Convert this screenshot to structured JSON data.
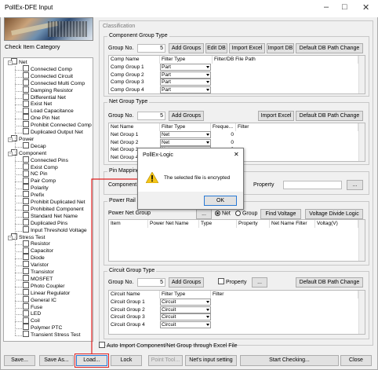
{
  "window": {
    "title": "PollEx-DFE Input"
  },
  "left": {
    "header": "Check Item Category",
    "tree": [
      {
        "label": "Net",
        "level": 0
      },
      {
        "label": "Connected Comp",
        "level": 1
      },
      {
        "label": "Connected Circuit",
        "level": 1
      },
      {
        "label": "Connected Multi Comp",
        "level": 1
      },
      {
        "label": "Damping Resistor",
        "level": 1
      },
      {
        "label": "Differential Net",
        "level": 1
      },
      {
        "label": "Exist Net",
        "level": 1
      },
      {
        "label": "Load Capacitance",
        "level": 1
      },
      {
        "label": "One Pin Net",
        "level": 1
      },
      {
        "label": "Prohibit Connected Comp",
        "level": 1
      },
      {
        "label": "Duplicated Output Net",
        "level": 1
      },
      {
        "label": "Power",
        "level": 0
      },
      {
        "label": "Decap",
        "level": 1
      },
      {
        "label": "Component",
        "level": 0
      },
      {
        "label": "Connected Pins",
        "level": 1
      },
      {
        "label": "Exist Comp",
        "level": 1
      },
      {
        "label": "NC Pin",
        "level": 1
      },
      {
        "label": "Pair Comp",
        "level": 1
      },
      {
        "label": "Polarity",
        "level": 1
      },
      {
        "label": "Prefix",
        "level": 1
      },
      {
        "label": "Prohibit Duplicated Net",
        "level": 1
      },
      {
        "label": "Prohibited Component",
        "level": 1
      },
      {
        "label": "Standard Net Name",
        "level": 1
      },
      {
        "label": "Duplicated Pins",
        "level": 1
      },
      {
        "label": "Input Threshold Voltage",
        "level": 1
      },
      {
        "label": "Stress Test",
        "level": 0
      },
      {
        "label": "Resistor",
        "level": 1
      },
      {
        "label": "Capacitor",
        "level": 1
      },
      {
        "label": "Diode",
        "level": 1
      },
      {
        "label": "Varistor",
        "level": 1
      },
      {
        "label": "Transistor",
        "level": 1
      },
      {
        "label": "MOSFET",
        "level": 1
      },
      {
        "label": "Photo Coupler",
        "level": 1
      },
      {
        "label": "Linear Regulator",
        "level": 1
      },
      {
        "label": "General IC",
        "level": 1
      },
      {
        "label": "Fuse",
        "level": 1
      },
      {
        "label": "LED",
        "level": 1
      },
      {
        "label": "Coil",
        "level": 1
      },
      {
        "label": "Polymer PTC",
        "level": 1
      },
      {
        "label": "Transient Stress Test",
        "level": 1
      }
    ]
  },
  "classification": {
    "header": "Classification",
    "component_group": {
      "title": "Component Group Type",
      "group_no_label": "Group No.",
      "group_no": "5",
      "buttons": [
        "Add Groups",
        "Edit DB",
        "Import Excel",
        "Import DB",
        "Default DB Path Change"
      ],
      "columns": [
        "Comp Name",
        "Filter Type",
        "Filter/DB File Path"
      ],
      "rows": [
        [
          "Comp Group 1",
          "Part"
        ],
        [
          "Comp Group 2",
          "Part"
        ],
        [
          "Comp Group 3",
          "Part"
        ],
        [
          "Comp Group 4",
          "Part"
        ]
      ]
    },
    "net_group": {
      "title": "Net Group Type",
      "group_no_label": "Group No.",
      "group_no": "5",
      "add_button": "Add Groups",
      "import_button": "Import Excel",
      "default_button": "Default DB Path Change",
      "columns": [
        "Net Name",
        "Filter Type",
        "Freque...",
        "Filter"
      ],
      "rows": [
        [
          "Net Group 1",
          "Net",
          "0"
        ],
        [
          "Net Group 2",
          "Net",
          "0"
        ],
        [
          "Net Group 3",
          "Net",
          "0"
        ],
        [
          "Net Group 4",
          "Net",
          "0"
        ]
      ]
    },
    "pin_mapping": {
      "title": "Pin Mapping",
      "component_label": "Component",
      "property_label": "Property",
      "browse": "..."
    },
    "power_rail": {
      "title": "Power Rail",
      "power_net_group_label": "Power Net Group",
      "browse": "...",
      "radio_net": "Net",
      "radio_group": "Group",
      "find_voltage": "Find Voltage",
      "voltage_divide": "Voltage Divide Logic",
      "columns": [
        "Item",
        "Power Net Name",
        "Type",
        "Property",
        "Net Name Filter",
        "Voltag(V)"
      ]
    },
    "circuit_group": {
      "title": "Circuit Group Type",
      "group_no_label": "Group No.",
      "group_no": "5",
      "add_button": "Add Groups",
      "property_label": "Property",
      "browse": "...",
      "default_button": "Default DB Path Change",
      "columns": [
        "Circuit Name",
        "Filter Type",
        "Filter"
      ],
      "rows": [
        [
          "Circuit Group 1",
          "Circuit"
        ],
        [
          "Circuit Group 2",
          "Circuit"
        ],
        [
          "Circuit Group 3",
          "Circuit"
        ],
        [
          "Circuit Group 4",
          "Circuit"
        ]
      ]
    },
    "auto_import_label": "Auto Import Component/Net Group through Excel File"
  },
  "bottom_buttons": {
    "save": "Save...",
    "save_as": "Save As...",
    "load": "Load...",
    "lock": "Lock",
    "point_tool": "Point Tool...",
    "nets_input": "Net's input setting",
    "start": "Start Checking...",
    "close": "Close"
  },
  "dialog": {
    "title": "PollEx-Logic",
    "message": "The selected file is encrypted",
    "ok": "OK",
    "close_glyph": "✕",
    "icon": "warning-icon"
  },
  "colors": {
    "highlight": "#e02020",
    "warning": "#f5c518"
  }
}
